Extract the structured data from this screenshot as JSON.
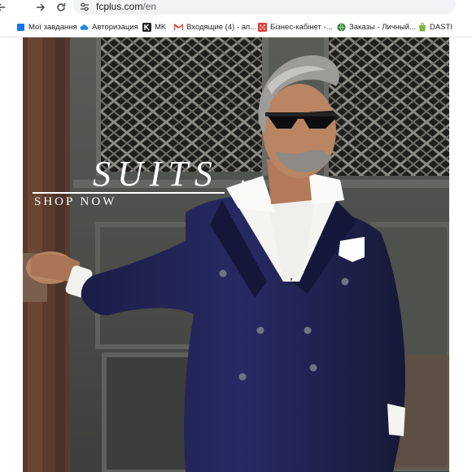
{
  "browser": {
    "address_bar": {
      "host": "fcplus.com",
      "path": "/en",
      "back_icon": "arrow-left-icon",
      "forward_icon": "arrow-right-icon",
      "reload_icon": "reload-icon",
      "site_info_icon": "tune-icon"
    },
    "bookmarks": [
      {
        "label": "Мої завдання",
        "icon": "bookmark-icon"
      },
      {
        "label": "Авторизация",
        "icon": "cloud-icon"
      },
      {
        "label": "MK",
        "icon": "k-logo-icon"
      },
      {
        "label": "Входящие (4) - ап...",
        "icon": "gmail-icon"
      },
      {
        "label": "Бізнес-кабінет -...",
        "icon": "red-dice-icon"
      },
      {
        "label": "Заказы - Личный...",
        "icon": "green-globe-icon"
      },
      {
        "label": "DASTI",
        "icon": "shopify-bag-icon"
      }
    ]
  },
  "hero": {
    "title": "SUITS",
    "cta": "SHOP NOW"
  },
  "colors": {
    "suit": "#1c1f4a",
    "wall": "#4a4d4c",
    "text": "#ffffff"
  }
}
